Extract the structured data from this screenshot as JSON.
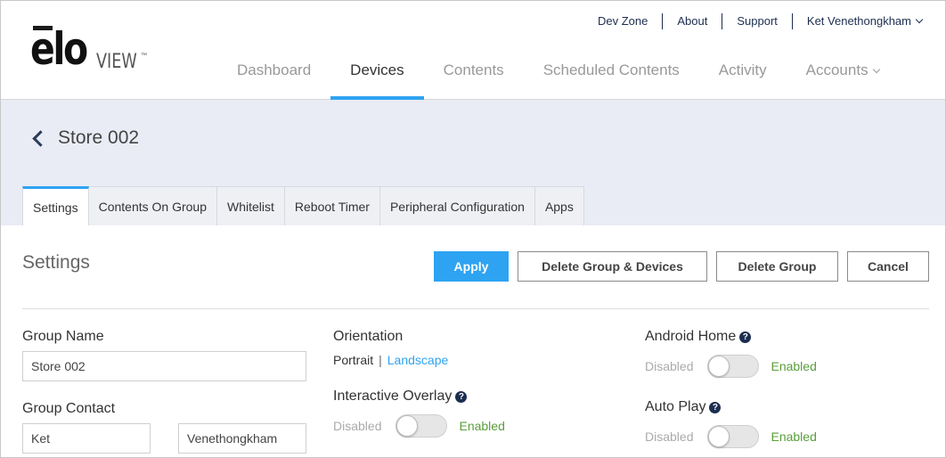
{
  "brand": {
    "logo_main": "elo",
    "logo_sub": "VIEW",
    "logo_tm": "™"
  },
  "topnav": {
    "dev_zone": "Dev Zone",
    "about": "About",
    "support": "Support",
    "user": "Ket Venethongkham"
  },
  "mainnav": {
    "dashboard": "Dashboard",
    "devices": "Devices",
    "contents": "Contents",
    "scheduled": "Scheduled Contents",
    "activity": "Activity",
    "accounts": "Accounts"
  },
  "page": {
    "title": "Store 002"
  },
  "tabs": {
    "settings": "Settings",
    "contents_on_group": "Contents On Group",
    "whitelist": "Whitelist",
    "reboot_timer": "Reboot Timer",
    "peripheral": "Peripheral Configuration",
    "apps": "Apps"
  },
  "settings": {
    "title": "Settings",
    "apply": "Apply",
    "delete_group_devices": "Delete Group & Devices",
    "delete_group": "Delete Group",
    "cancel": "Cancel"
  },
  "form": {
    "group_name_label": "Group Name",
    "group_name_value": "Store 002",
    "group_contact_label": "Group Contact",
    "contact_first": "Ket",
    "contact_last": "Venethongkham",
    "orientation_label": "Orientation",
    "orientation_portrait": "Portrait",
    "orientation_sep": "|",
    "orientation_landscape": "Landscape",
    "interactive_overlay_label": "Interactive Overlay",
    "android_home_label": "Android Home",
    "auto_play_label": "Auto Play",
    "disabled": "Disabled",
    "enabled": "Enabled",
    "help_glyph": "?"
  },
  "toggles": {
    "interactive_overlay": false,
    "android_home": false,
    "auto_play": false
  },
  "colors": {
    "accent": "#2ea3f2",
    "navy": "#1c2d4f",
    "enabled_green": "#5a9e3a",
    "band_bg": "#e9ecf5"
  }
}
